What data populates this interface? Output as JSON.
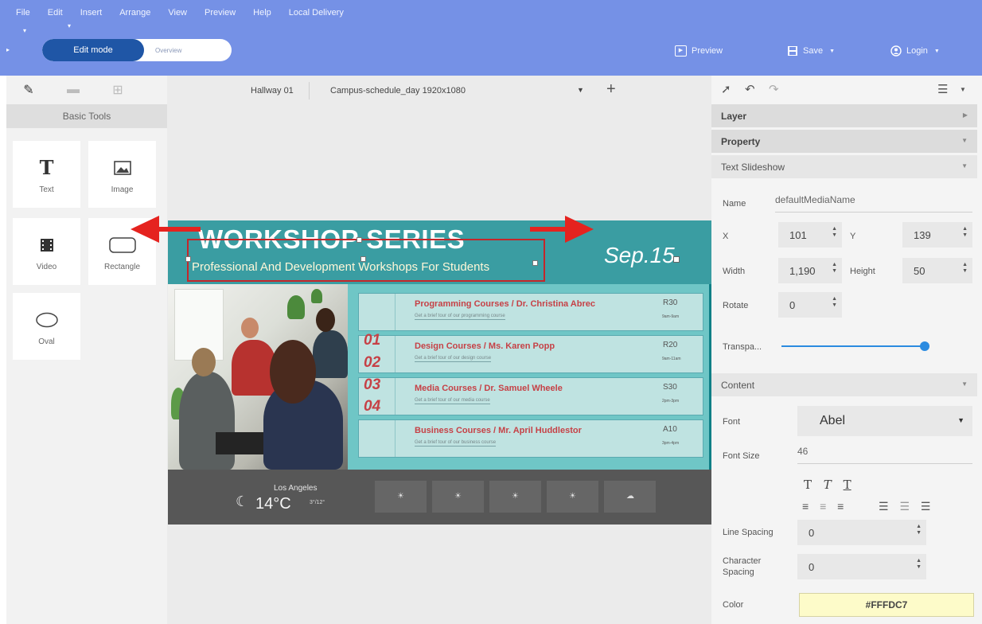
{
  "menu": [
    "File",
    "Edit",
    "Insert",
    "Arrange",
    "View",
    "Preview",
    "Help",
    "Local Delivery"
  ],
  "mode": {
    "edit": "Edit mode",
    "overview": "Overview"
  },
  "top_actions": {
    "preview": "Preview",
    "save": "Save",
    "login": "Login"
  },
  "left_panel": {
    "title": "Basic Tools",
    "tools": [
      "Text",
      "Image",
      "Video",
      "Rectangle",
      "Oval"
    ]
  },
  "canvas": {
    "screen": "Hallway 01",
    "template": "Campus-schedule_day 1920x1080"
  },
  "slide": {
    "title": "WORKSHOP SERIES",
    "subtitle": "Professional And Development Workshops For Students",
    "date": "Sep.15",
    "numbers": [
      "01",
      "02",
      "03",
      "04"
    ],
    "courses": [
      {
        "title": "Programming Courses / Dr. Christina Abrec",
        "desc": "Get a brief tour of our programming course",
        "room": "R30",
        "time": "9am-9am"
      },
      {
        "title": "Design Courses / Ms. Karen Popp",
        "desc": "Get a brief tour of our design course",
        "room": "R20",
        "time": "9am-11am"
      },
      {
        "title": "Media Courses / Dr. Samuel Wheele",
        "desc": "Get a brief tour of our media course",
        "room": "S30",
        "time": "2pm-3pm"
      },
      {
        "title": "Business Courses / Mr. April Huddlestor",
        "desc": "Get a brief tour of our business course",
        "room": "A10",
        "time": "3pm-4pm"
      }
    ],
    "weather": {
      "city": "Los Angeles",
      "temp": "14°C",
      "range": "3°/12°"
    }
  },
  "right_panel": {
    "sections": {
      "layer": "Layer",
      "property": "Property",
      "text_slideshow": "Text Slideshow",
      "content": "Content"
    },
    "labels": {
      "name": "Name",
      "x": "X",
      "y": "Y",
      "width": "Width",
      "height": "Height",
      "rotate": "Rotate",
      "transparency": "Transpa...",
      "font": "Font",
      "font_size": "Font Size",
      "line_spacing": "Line Spacing",
      "character_spacing": "Character Spacing",
      "color": "Color"
    },
    "values": {
      "name": "defaultMediaName",
      "x": "101",
      "y": "139",
      "width": "1,190",
      "height": "50",
      "rotate": "0",
      "font": "Abel",
      "font_size": "46",
      "line_spacing": "0",
      "character_spacing": "0",
      "color": "#FFFDC7"
    },
    "transparency": 1.0
  },
  "colors": {
    "topbar": "#7591e6",
    "edit_mode": "#1f56a6",
    "accent_red": "#e5231f",
    "slider": "#2b8be0",
    "color_swatch": "#FFFDC7"
  }
}
